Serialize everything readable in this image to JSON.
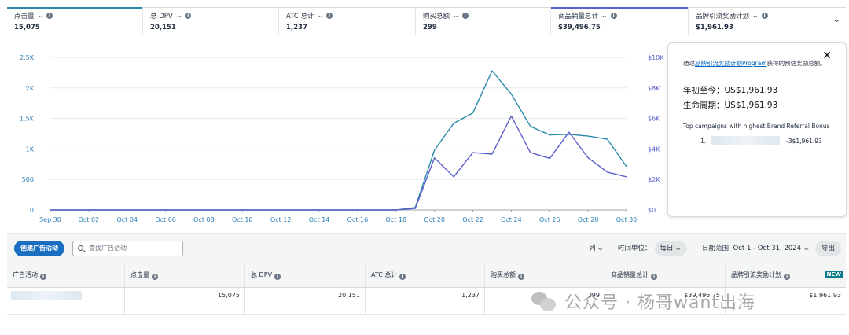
{
  "tabs": [
    {
      "label": "点击量",
      "value": "15,075"
    },
    {
      "label": "总 DPV",
      "value": "20,151"
    },
    {
      "label": "ATC 总计",
      "value": "1,237"
    },
    {
      "label": "购买总额",
      "value": "299"
    },
    {
      "label": "商品销量总计",
      "value": "$39,496.75"
    },
    {
      "label": "品牌引流奖励计划",
      "value": "$1,961.93"
    }
  ],
  "colors": {
    "series1": "#2a8aa9",
    "series2": "#5a5fcb",
    "primary_button": "#1a6ec0",
    "link": "#0066c0"
  },
  "chart_data": {
    "type": "line",
    "x_ticks": [
      "Sep 30",
      "Oct 02",
      "Oct 04",
      "Oct 06",
      "Oct 08",
      "Oct 10",
      "Oct 12",
      "Oct 14",
      "Oct 16",
      "Oct 18",
      "Oct 20",
      "Oct 22",
      "Oct 24",
      "Oct 26",
      "Oct 28",
      "Oct 30"
    ],
    "y_left_ticks": [
      "0",
      "500",
      "1K",
      "1.5K",
      "2K",
      "2.5K"
    ],
    "y_right_ticks": [
      "$0",
      "$2K",
      "$4K",
      "$6K",
      "$8K",
      "$10K"
    ],
    "ylim_left": [
      0,
      2500
    ],
    "ylim_right": [
      0,
      10000
    ],
    "x": [
      "Sep 30",
      "Oct 01",
      "Oct 02",
      "Oct 03",
      "Oct 04",
      "Oct 05",
      "Oct 06",
      "Oct 07",
      "Oct 08",
      "Oct 09",
      "Oct 10",
      "Oct 11",
      "Oct 12",
      "Oct 13",
      "Oct 14",
      "Oct 15",
      "Oct 16",
      "Oct 17",
      "Oct 18",
      "Oct 19",
      "Oct 20",
      "Oct 21",
      "Oct 22",
      "Oct 23",
      "Oct 24",
      "Oct 25",
      "Oct 26",
      "Oct 27",
      "Oct 28",
      "Oct 29",
      "Oct 30"
    ],
    "series": [
      {
        "axis": "left",
        "color": "#2a8aa9",
        "values": [
          0,
          0,
          0,
          0,
          0,
          0,
          0,
          0,
          0,
          0,
          0,
          0,
          0,
          0,
          0,
          0,
          0,
          0,
          0,
          40,
          980,
          1420,
          1590,
          2280,
          1900,
          1370,
          1230,
          1240,
          1210,
          1160,
          710
        ]
      },
      {
        "axis": "right",
        "color": "#5a5fcb",
        "values": [
          0,
          0,
          0,
          0,
          0,
          0,
          0,
          0,
          0,
          0,
          0,
          0,
          0,
          0,
          0,
          0,
          0,
          0,
          0,
          100,
          3420,
          2170,
          3760,
          3660,
          6160,
          3760,
          3380,
          5100,
          3420,
          2480,
          2170
        ]
      }
    ],
    "grid": true
  },
  "panel": {
    "close": "✕",
    "desc_before": "通过",
    "desc_link": "品牌引流奖励计划Program",
    "desc_after": "获得的预估奖励总额。",
    "ytd": "年初至今：US$1,961.93",
    "lifetime": "生命周期：US$1,961.93",
    "top_title": "Top campaigns with highest Brand Referral Bonus",
    "top_index": "1.",
    "top_value": "-3$1,961.93"
  },
  "toolbar": {
    "create": "创建广告活动",
    "search_placeholder": "查找广告活动",
    "columns": "列",
    "time_unit_label": "时间单位：",
    "time_unit_value": "每日",
    "date_range": "日期范围: Oct 1 - Oct 31, 2024",
    "export": "导出"
  },
  "table": {
    "headers": [
      "广告活动",
      "点击量",
      "总 DPV",
      "ATC 总计",
      "购买总额",
      "商品销量总计",
      "品牌引流奖励计划"
    ],
    "new_badge": "NEW",
    "row": [
      "15,075",
      "20,151",
      "1,237",
      "299",
      "$39,496.75",
      "$1,961.93"
    ]
  },
  "watermark": "公众号 · 杨哥want出海"
}
